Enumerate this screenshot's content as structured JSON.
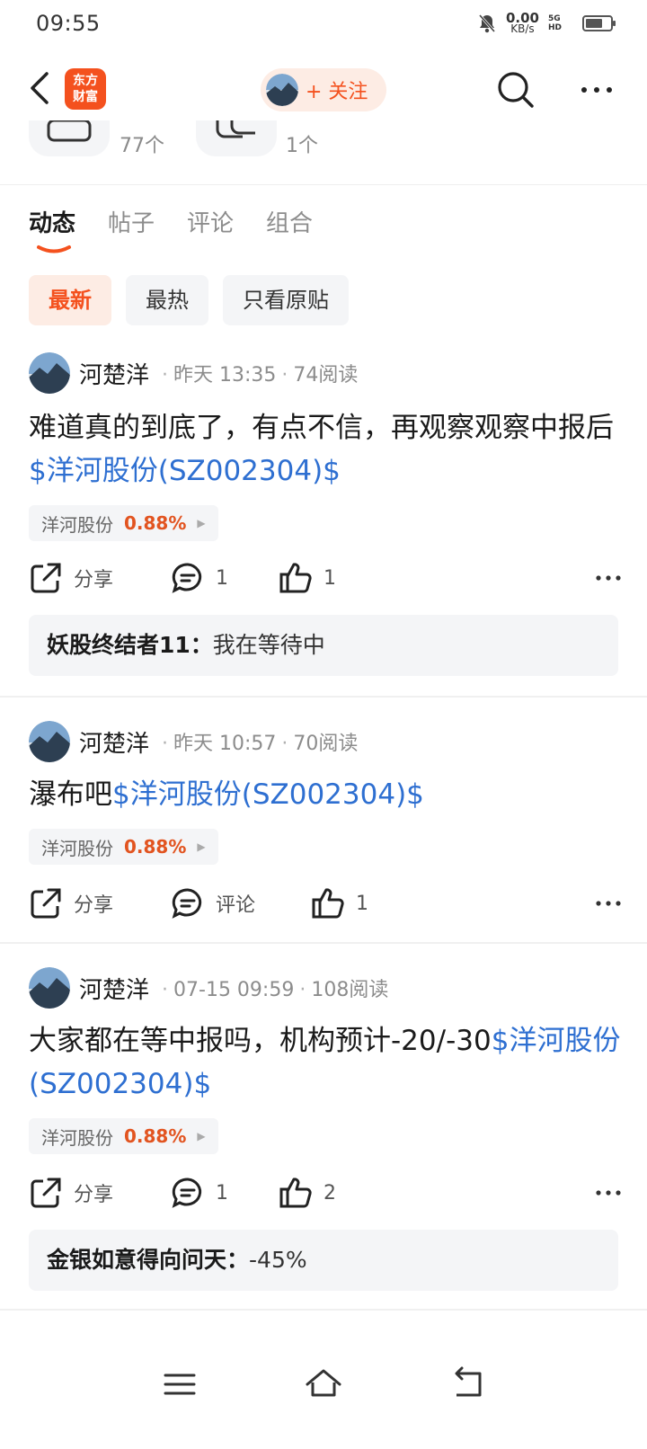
{
  "status": {
    "time": "09:55",
    "speed_value": "0.00",
    "speed_unit": "KB/s",
    "network": "5G HD",
    "battery_level": 0.7
  },
  "nav": {
    "logo_text": "东方\n财富",
    "follow_label": "+ 关注"
  },
  "stats": {
    "count1": "77个",
    "count2": "1个"
  },
  "tabs": [
    "动态",
    "帖子",
    "评论",
    "组合"
  ],
  "filters": [
    "最新",
    "最热",
    "只看原贴"
  ],
  "posts": [
    {
      "author": "河楚洋",
      "time": "昨天 13:35",
      "reads": "74阅读",
      "text": "难道真的到底了，有点不信，再观察观察中报后",
      "stock_link": "$洋河股份(SZ002304)$",
      "stock_name": "洋河股份",
      "stock_pct": "0.88%",
      "share_label": "分享",
      "comment_label": "1",
      "like_label": "1",
      "reply_author": "妖股终结者11：",
      "reply_text": "我在等待中"
    },
    {
      "author": "河楚洋",
      "time": "昨天 10:57",
      "reads": "70阅读",
      "text": "瀑布吧",
      "stock_link": "$洋河股份(SZ002304)$",
      "stock_name": "洋河股份",
      "stock_pct": "0.88%",
      "share_label": "分享",
      "comment_label": "评论",
      "like_label": "1"
    },
    {
      "author": "河楚洋",
      "time": "07-15 09:59",
      "reads": "108阅读",
      "text": "大家都在等中报吗，机构预计-20/-30",
      "stock_link": "$洋河股份(SZ002304)$",
      "stock_name": "洋河股份",
      "stock_pct": "0.88%",
      "share_label": "分享",
      "comment_label": "1",
      "like_label": "2",
      "reply_author": "金银如意得向问天：",
      "reply_text": "-45%"
    }
  ],
  "colors": {
    "accent": "#f4511e",
    "link": "#2e6fd1",
    "pct": "#e25420"
  }
}
